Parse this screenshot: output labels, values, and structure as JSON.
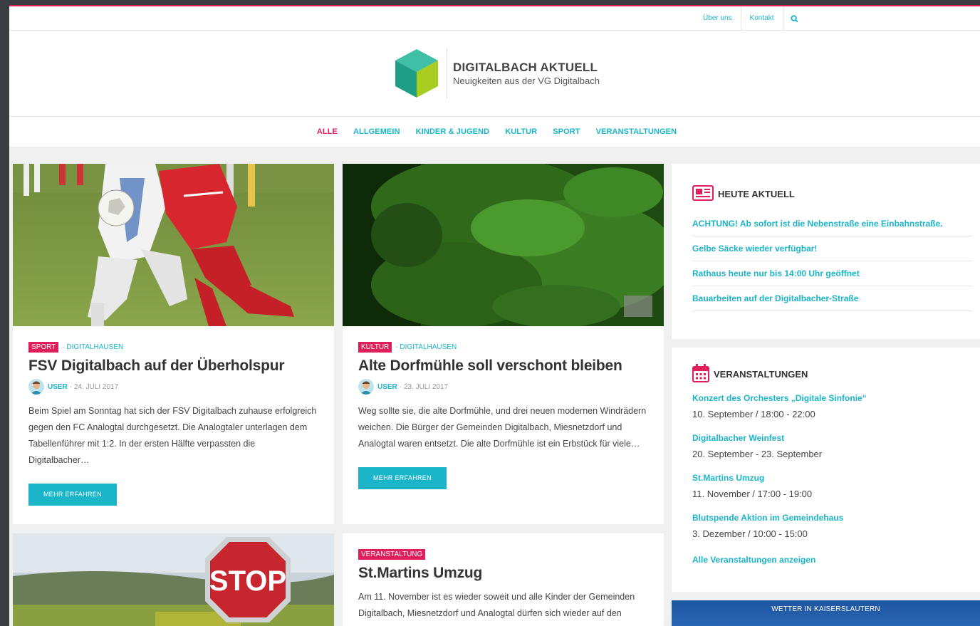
{
  "topnav": {
    "about": "Über uns",
    "contact": "Kontakt"
  },
  "site": {
    "title": "DIGITALBACH AKTUELL",
    "subtitle": "Neuigkeiten aus der VG Digitalbach"
  },
  "categories": [
    "ALLE",
    "ALLGEMEIN",
    "KINDER & JUGEND",
    "KULTUR",
    "SPORT",
    "VERANSTALTUNGEN"
  ],
  "posts": [
    {
      "tag": "SPORT",
      "location": "· DIGITALHAUSEN",
      "title": "FSV Digitalbach auf der Überholspur",
      "author": "USER",
      "date": "· 24. JULI 2017",
      "excerpt": "Beim Spiel am Sonntag hat sich der FSV Digitalbach zuhause erfolgreich gegen den FC Analogtal durchgesetzt. Die Analogtaler unterlagen dem Tabellenführer mit 1:2. In der ersten Hälfte verpassten die Digitalbacher…",
      "button": "MEHR ERFAHREN"
    },
    {
      "tag": "KULTUR",
      "location": "· DIGITALHAUSEN",
      "title": "Alte Dorfmühle soll verschont bleiben",
      "author": "USER",
      "date": "· 23. JULI 2017",
      "excerpt": "Weg sollte sie, die alte Dorfmühle, und drei neuen modernen Windrädern weichen. Die Bürger der Gemeinden Digitalbach, Miesnetzdorf und Analogtal waren entsetzt. Die alte Dorfmühle ist ein Erbstück für viele…",
      "button": "MEHR ERFAHREN"
    },
    {
      "image_text": "STOP"
    },
    {
      "tag": "VERANSTALTUNG",
      "title": "St.Martins Umzug",
      "excerpt": "Am 11. November ist es wieder soweit und alle Kinder der Gemeinden Digitalbach, Miesnetzdorf und Analogtal dürfen sich wieder auf den"
    }
  ],
  "today": {
    "heading": "HEUTE AKTUELL",
    "items": [
      "ACHTUNG! Ab sofort ist die Nebenstraße eine Einbahnstraße.",
      "Gelbe Säcke wieder verfügbar!",
      "Rathaus heute nur bis 14:00 Uhr geöffnet",
      "Bauarbeiten auf der Digitalbacher-Straße"
    ]
  },
  "events": {
    "heading": "VERANSTALTUNGEN",
    "items": [
      {
        "title": "Konzert des Orchesters „Digitale Sinfonie“",
        "date": "10. September / 18:00 - 22:00"
      },
      {
        "title": "Digitalbacher Weinfest",
        "date": "20. September - 23. September"
      },
      {
        "title": "St.Martins Umzug",
        "date": "11. November / 17:00 - 19:00"
      },
      {
        "title": "Blutspende Aktion im Gemeindehaus",
        "date": "3. Dezember / 10:00 - 15:00"
      }
    ],
    "all_link": "Alle Veranstaltungen anzeigen"
  },
  "weather": {
    "heading": "WETTER IN KAISERSLAUTERN"
  },
  "colors": {
    "accent": "#1bb5c9",
    "highlight": "#e01e5a"
  }
}
